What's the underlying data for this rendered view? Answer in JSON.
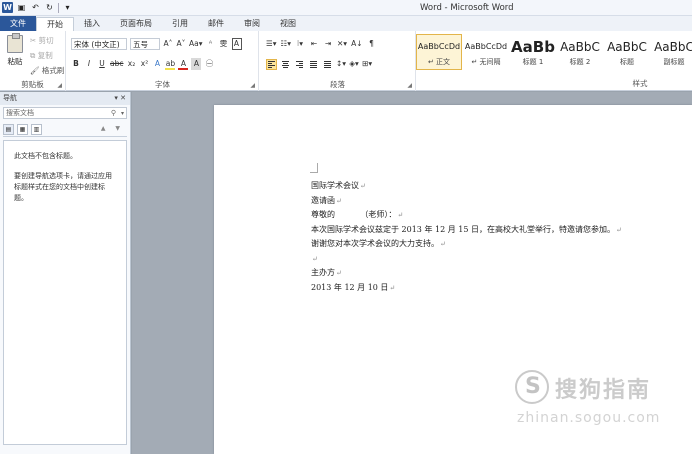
{
  "window": {
    "title": "Word - Microsoft Word"
  },
  "qat": {
    "logo": "W",
    "save": "▣",
    "undo": "↶",
    "redo": "↻",
    "customize": "▾"
  },
  "tabs": [
    "文件",
    "开始",
    "插入",
    "页面布局",
    "引用",
    "邮件",
    "审阅",
    "视图"
  ],
  "ribbon": {
    "clipboard": {
      "paste": "粘贴",
      "cut": "✂ 剪切",
      "copy": "⧉ 复制",
      "format_painter": "🖌 格式刷",
      "label": "剪贴板"
    },
    "font": {
      "font_name": "宋体 (中文正)",
      "font_size": "五号",
      "grow": "A˄",
      "shrink": "A˅",
      "change_case": "Aa▾",
      "clear": "ᴬ",
      "phonetic": "雯",
      "border_char": "A",
      "bold": "B",
      "italic": "I",
      "underline": "U",
      "strike": "abc",
      "subscript": "x₂",
      "superscript": "x²",
      "text_effect": "A",
      "highlight": "ab",
      "font_color": "A",
      "shading": "A",
      "enclose": "㊀",
      "label": "字体"
    },
    "paragraph": {
      "bullets": "☰▾",
      "numbering": "☷▾",
      "multilevel": "⁝▾",
      "decrease_indent": "⇤",
      "increase_indent": "⇥",
      "chinese_layout": "✕▾",
      "sort": "A↓",
      "show_marks": "¶",
      "line_spacing": "↕▾",
      "shading": "◈▾",
      "borders": "⊞▾",
      "label": "段落"
    },
    "styles": {
      "label": "样式",
      "items": [
        {
          "sample": "AaBbCcDd",
          "name": "↵ 正文",
          "selected": true
        },
        {
          "sample": "AaBbCcDd",
          "name": "↵ 无间隔",
          "selected": false
        },
        {
          "sample": "AaBb",
          "name": "标题 1",
          "selected": false
        },
        {
          "sample": "AaBbC",
          "name": "标题 2",
          "selected": false
        },
        {
          "sample": "AaBbC",
          "name": "标题",
          "selected": false
        },
        {
          "sample": "AaBbC",
          "name": "副标题",
          "selected": false
        }
      ]
    }
  },
  "nav_pane": {
    "title": "导航",
    "controls": "▾ ✕",
    "search_placeholder": "搜索文档",
    "search_icon": "⚲",
    "tab_icons": [
      "▤",
      "▦",
      "▥"
    ],
    "arrows": "▲ ▼",
    "msg_no_headings": "此文档不包含标题。",
    "msg_hint": "要创建导航选项卡，请通过应用标题样式在您的文档中创建标题。"
  },
  "document": {
    "lines": [
      {
        "text": "国际学术会议",
        "mark": "↵"
      },
      {
        "text": "邀请函",
        "mark": "↵"
      },
      {
        "text": "尊敬的          （老师）：",
        "mark": "↵"
      },
      {
        "text": "本次国际学术会议兹定于 2013 年 12 月 15 日，在高校大礼堂举行，特邀请您参加。",
        "mark": "↵"
      },
      {
        "text": "谢谢您对本次学术会议的大力支持。",
        "mark": "↵"
      },
      {
        "text": "",
        "mark": "↵"
      },
      {
        "text": "主办方",
        "mark": "↵"
      },
      {
        "text": "2013 年 12 月 10 日",
        "mark": "↵"
      }
    ]
  },
  "watermark": {
    "brand": "搜狗指南",
    "url": "zhinan.sogou.com"
  },
  "colors": {
    "accent": "#2b579a",
    "style_selected": "#e3b54a"
  }
}
